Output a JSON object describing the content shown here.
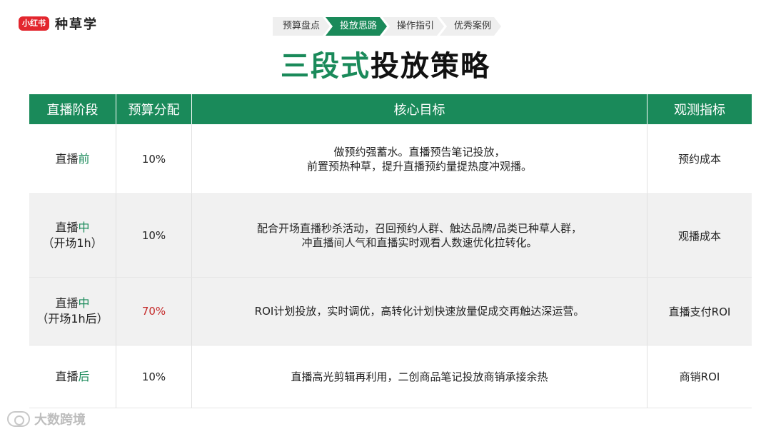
{
  "brand": {
    "logo": "小红书",
    "name": "种草学"
  },
  "steps": [
    "预算盘点",
    "投放思路",
    "操作指引",
    "优秀案例"
  ],
  "title": {
    "accent": "三段式",
    "rest": "投放策略"
  },
  "table": {
    "headers": [
      "直播阶段",
      "预算分配",
      "核心目标",
      "观测指标"
    ],
    "rows": [
      {
        "stage": "直播",
        "stage_accent": "前",
        "stage_sub": "",
        "budget": "10%",
        "goal_line1": "做预约强蓄水。直播预告笔记投放，",
        "goal_line2": "前置预热种草，提升直播预约量提热度冲观播。",
        "metric": "预约成本"
      },
      {
        "stage": "直播",
        "stage_accent": "中",
        "stage_sub": "（开场1h）",
        "budget": "10%",
        "goal_line1": "配合开场直播秒杀活动，召回预约人群、触达品牌/品类已种草人群，",
        "goal_line2": "冲直播间人气和直播实时观看人数速优化拉转化。",
        "metric": "观播成本"
      },
      {
        "stage": "直播",
        "stage_accent": "中",
        "stage_sub": "（开场1h后）",
        "budget": "70%",
        "goal_line1": "ROI计划投放，实时调优，高转化计划快速放量促成交再触达深运营。",
        "goal_line2": "",
        "metric": "直播支付ROI"
      },
      {
        "stage": "直播",
        "stage_accent": "后",
        "stage_sub": "",
        "budget": "10%",
        "goal_line1": "直播高光剪辑再利用，二创商品笔记投放商销承接余热",
        "goal_line2": "",
        "metric": "商销ROI"
      }
    ]
  },
  "watermark": "大数跨境",
  "colors": {
    "accent": "#1a8a5a",
    "highlight": "#c42a2a",
    "brand": "#e3262e"
  }
}
